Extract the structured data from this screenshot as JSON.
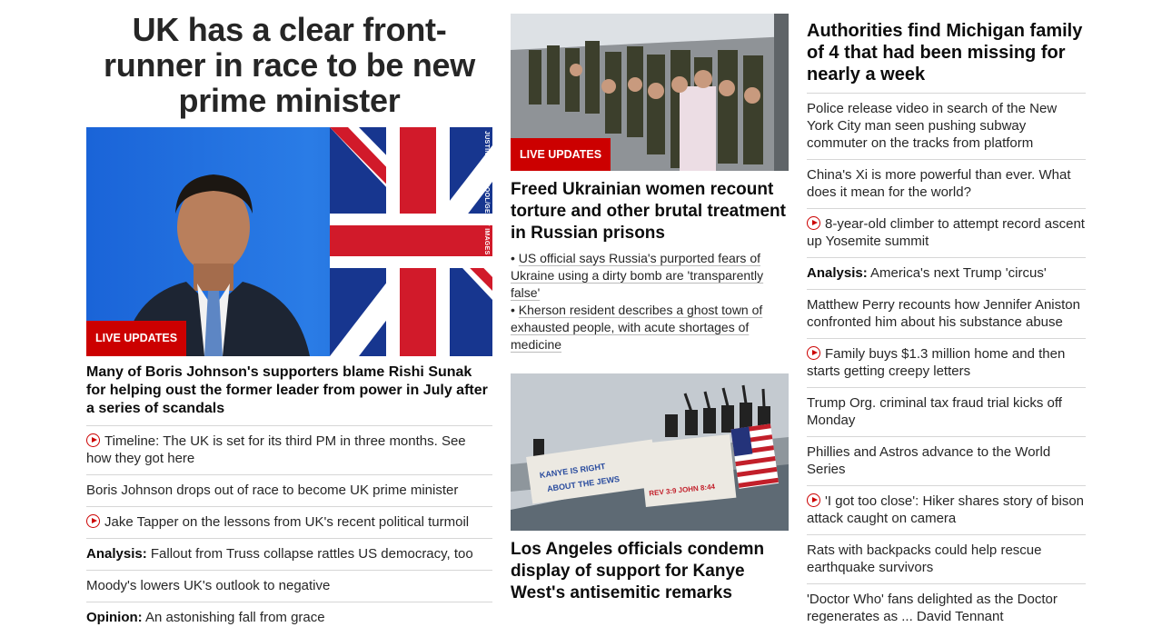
{
  "left": {
    "headline": "UK has a clear front-runner in race to be new prime minister",
    "image_badge": "LIVE UPDATES",
    "image_credit": "JUSTIN TALLIS/POOL/GETTY IMAGES",
    "subhead": "Many of Boris Johnson's supporters blame Rishi Sunak for helping oust the former leader from power in July after a series of scandals",
    "links": [
      {
        "prefix": "",
        "text": "Timeline: The UK is set for its third PM in three months. See how they got here",
        "video": true
      },
      {
        "prefix": "",
        "text": "Boris Johnson drops out of race to become UK prime minister",
        "video": false
      },
      {
        "prefix": "",
        "text": "Jake Tapper on the lessons from UK's recent political turmoil",
        "video": true
      },
      {
        "prefix": "Analysis:",
        "text": "Fallout from Truss collapse rattles US democracy, too",
        "video": false
      },
      {
        "prefix": "",
        "text": "Moody's lowers UK's outlook to negative",
        "video": false
      },
      {
        "prefix": "Opinion:",
        "text": "An astonishing fall from grace",
        "video": false
      }
    ]
  },
  "middle": {
    "story1": {
      "badge": "LIVE UPDATES",
      "headline": "Freed Ukrainian women recount torture and other brutal treatment in Russian prisons",
      "bullets": [
        "US official says Russia's purported fears of Ukraine using a dirty bomb are 'transparently false'",
        "Kherson resident describes a ghost town of exhausted people, with acute shortages of medicine"
      ]
    },
    "story2": {
      "banner1_line1": "KANYE IS RIGHT",
      "banner1_line2": "ABOUT THE JEWS",
      "banner2_line": "REV 3:9 JOHN 8:44",
      "headline": "Los Angeles officials condemn display of support for Kanye West's antisemitic remarks"
    }
  },
  "right": {
    "headline": "Authorities find Michigan family of 4 that had been missing for nearly a week",
    "links": [
      {
        "prefix": "",
        "text": "Police release video in search of the New York City man seen pushing subway commuter on the tracks from platform",
        "video": false
      },
      {
        "prefix": "",
        "text": "China's Xi is more powerful than ever. What does it mean for the world?",
        "video": false
      },
      {
        "prefix": "",
        "text": "8-year-old climber to attempt record ascent up Yosemite summit",
        "video": true
      },
      {
        "prefix": "Analysis:",
        "text": "America's next Trump 'circus'",
        "video": false
      },
      {
        "prefix": "",
        "text": "Matthew Perry recounts how Jennifer Aniston confronted him about his substance abuse",
        "video": false
      },
      {
        "prefix": "",
        "text": "Family buys $1.3 million home and then starts getting creepy letters",
        "video": true
      },
      {
        "prefix": "",
        "text": "Trump Org. criminal tax fraud trial kicks off Monday",
        "video": false
      },
      {
        "prefix": "",
        "text": "Phillies and Astros advance to the World Series",
        "video": false
      },
      {
        "prefix": "",
        "text": "'I got too close': Hiker shares story of bison attack caught on camera",
        "video": true
      },
      {
        "prefix": "",
        "text": "Rats with backpacks could help rescue earthquake survivors",
        "video": false
      },
      {
        "prefix": "",
        "text": "'Doctor Who' fans delighted as the Doctor regenerates as ... David Tennant",
        "video": false
      }
    ]
  },
  "colors": {
    "accent_red": "#cc0000",
    "divider": "#d6d6d6",
    "text": "#0c0c0c"
  }
}
